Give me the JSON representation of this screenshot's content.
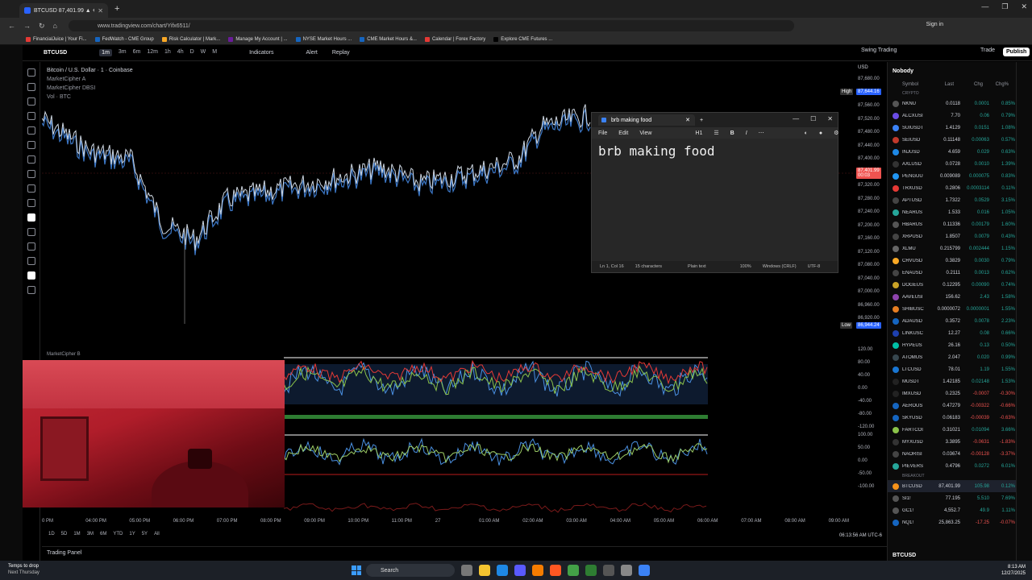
{
  "browser": {
    "tab_title": "BTCUSD 87,401.99 ▲ +0.12% S",
    "url": "www.tradingview.com/chart/Yifx6511/",
    "signin": "Sign in",
    "bookmarks": [
      "FinancialJuice | Your Fi...",
      "FedWatch - CME Group",
      "Risk Calculator | Mark...",
      "Manage My Account | ...",
      "NYSE Market Hours ...",
      "CME Market Hours &...",
      "Calendar | Forex Factory",
      "Explore CME Futures ..."
    ]
  },
  "toolbar": {
    "symbol": "BTCUSD",
    "timeframes": [
      "1m",
      "3m",
      "6m",
      "12m",
      "1h",
      "4h",
      "D",
      "W",
      "M"
    ],
    "active_timeframe": "1m",
    "indicators": "Indicators",
    "alert": "Alert",
    "replay": "Replay",
    "layout": "Swing Trading",
    "trade": "Trade",
    "publish": "Publish"
  },
  "chart": {
    "title": "Bitcoin / U.S. Dollar · 1 · Coinbase",
    "indicator1": "MarketCipher A",
    "indicator2": "MarketCipher DBSI",
    "indicator3": "Vol · BTC",
    "pane_label": "MarketCipher B",
    "currency": "USD",
    "high_label": "High",
    "high_value": "87,644.16",
    "low_label": "Low",
    "low_value": "86,944.24",
    "current_price": "87,401.99",
    "countdown": "00:03",
    "price_ticks": [
      "87,680.00",
      "87,600.00",
      "87,560.00",
      "87,520.00",
      "87,480.00",
      "87,440.00",
      "87,400.00",
      "87,360.00",
      "87,320.00",
      "87,280.00",
      "87,240.00",
      "87,200.00",
      "87,160.00",
      "87,120.00",
      "87,080.00",
      "87,040.00",
      "87,000.00",
      "86,960.00",
      "86,920.00"
    ],
    "osc_ticks": [
      "120.00",
      "80.00",
      "40.00",
      "0.00",
      "-40.00",
      "-80.00",
      "-120.00",
      "100.00",
      "50.00",
      "0.00",
      "-50.00",
      "-100.00"
    ],
    "time_ticks": [
      "0 PM",
      "04:00 PM",
      "05:00 PM",
      "06:00 PM",
      "07:00 PM",
      "08:00 PM",
      "09:00 PM",
      "10:00 PM",
      "11:00 PM",
      "27",
      "01:00 AM",
      "02:00 AM",
      "03:00 AM",
      "04:00 AM",
      "05:00 AM",
      "06:00 AM",
      "07:00 AM",
      "08:00 AM",
      "09:00 AM"
    ],
    "ranges": [
      "1D",
      "5D",
      "1M",
      "3M",
      "6M",
      "YTD",
      "1Y",
      "5Y",
      "All"
    ],
    "server_time": "06:13:56 AM UTC-6",
    "trading_panel": "Trading Panel"
  },
  "notepad": {
    "tab_title": "brb making food",
    "menu": [
      "File",
      "Edit",
      "View"
    ],
    "heading_btn": "H1",
    "content": "brb making food",
    "status": [
      "Ln 1, Col 16",
      "15 characters",
      "Plain text",
      "100%",
      "Windows (CRLF)",
      "UTF-8"
    ]
  },
  "watchlist": {
    "title": "Nobody",
    "cols": [
      "Symbol",
      "Last",
      "Chg",
      "Chg%"
    ],
    "section1": "CRYPTO",
    "section2": "BREAKOUT",
    "rows": [
      {
        "s": "NKNU",
        "l": "0.0118",
        "c": "0.0001",
        "p": "0.85%",
        "dir": "up",
        "ic": "#555"
      },
      {
        "s": "ALCXUSI",
        "l": "7.70",
        "c": "0.06",
        "p": "0.79%",
        "dir": "up",
        "ic": "#6b4ce6"
      },
      {
        "s": "SUIUSDT",
        "l": "1.4129",
        "c": "0.0151",
        "p": "1.08%",
        "dir": "up",
        "ic": "#3b82f6"
      },
      {
        "s": "SEIUSD",
        "l": "0.11148",
        "c": "0.00063",
        "p": "0.57%",
        "dir": "up",
        "ic": "#c0392b"
      },
      {
        "s": "INJUSD",
        "l": "4.659",
        "c": "0.029",
        "p": "0.63%",
        "dir": "up",
        "ic": "#1e88e5"
      },
      {
        "s": "AXLUSD",
        "l": "0.0728",
        "c": "0.0010",
        "p": "1.39%",
        "dir": "up",
        "ic": "#333"
      },
      {
        "s": "PENGUU",
        "l": "0.009089",
        "c": "0.000075",
        "p": "0.83%",
        "dir": "up",
        "ic": "#2196f3"
      },
      {
        "s": "TRXUSD",
        "l": "0.2806",
        "c": "0.0003114",
        "p": "0.11%",
        "dir": "up",
        "ic": "#e53935"
      },
      {
        "s": "APTUSD",
        "l": "1.7322",
        "c": "0.0529",
        "p": "3.15%",
        "dir": "up",
        "ic": "#444"
      },
      {
        "s": "NEARUS",
        "l": "1.533",
        "c": "0.016",
        "p": "1.05%",
        "dir": "up",
        "ic": "#26a69a"
      },
      {
        "s": "HBARUS",
        "l": "0.11336",
        "c": "0.00179",
        "p": "1.60%",
        "dir": "up",
        "ic": "#555"
      },
      {
        "s": "XRPUSD",
        "l": "1.8507",
        "c": "0.0079",
        "p": "0.43%",
        "dir": "up",
        "ic": "#444"
      },
      {
        "s": "XLMU",
        "l": "0.215799",
        "c": "0.002444",
        "p": "1.15%",
        "dir": "up",
        "ic": "#666"
      },
      {
        "s": "CRVUSD",
        "l": "0.3829",
        "c": "0.0030",
        "p": "0.79%",
        "dir": "up",
        "ic": "#f9a825"
      },
      {
        "s": "ENAUSD",
        "l": "0.2111",
        "c": "0.0013",
        "p": "0.62%",
        "dir": "up",
        "ic": "#444"
      },
      {
        "s": "DOGEUS",
        "l": "0.12295",
        "c": "0.00090",
        "p": "0.74%",
        "dir": "up",
        "ic": "#c9a227"
      },
      {
        "s": "AAVEUSI",
        "l": "156.62",
        "c": "2.43",
        "p": "1.58%",
        "dir": "up",
        "ic": "#8e44ad"
      },
      {
        "s": "SHIBUSC",
        "l": "0.0000072",
        "c": "0.0000001",
        "p": "1.55%",
        "dir": "up",
        "ic": "#e67e22"
      },
      {
        "s": "ADAUSD",
        "l": "0.3572",
        "c": "0.0078",
        "p": "2.23%",
        "dir": "up",
        "ic": "#1565c0"
      },
      {
        "s": "LINKUSC",
        "l": "12.27",
        "c": "0.08",
        "p": "0.66%",
        "dir": "up",
        "ic": "#1e40af"
      },
      {
        "s": "HYPEUS",
        "l": "26.16",
        "c": "0.13",
        "p": "0.50%",
        "dir": "up",
        "ic": "#00bfa5"
      },
      {
        "s": "ATOMUS",
        "l": "2.047",
        "c": "0.020",
        "p": "0.99%",
        "dir": "up",
        "ic": "#37474f"
      },
      {
        "s": "LTCUSD",
        "l": "78.01",
        "c": "1.19",
        "p": "1.55%",
        "dir": "up",
        "ic": "#1976d2"
      },
      {
        "s": "MUSDT",
        "l": "1.42185",
        "c": "0.02148",
        "p": "1.53%",
        "dir": "up",
        "ic": "#222"
      },
      {
        "s": "IMXUSD",
        "l": "0.2325",
        "c": "-0.0007",
        "p": "-0.30%",
        "dir": "dn",
        "ic": "#222"
      },
      {
        "s": "AEROUS",
        "l": "0.47279",
        "c": "-0.00322",
        "p": "-0.66%",
        "dir": "dn",
        "ic": "#1565c0"
      },
      {
        "s": "SKYUSD",
        "l": "0.06183",
        "c": "-0.00039",
        "p": "-0.63%",
        "dir": "dn",
        "ic": "#1565c0"
      },
      {
        "s": "FARTCOI",
        "l": "0.31021",
        "c": "0.01094",
        "p": "3.66%",
        "dir": "up",
        "ic": "#8bc34a"
      },
      {
        "s": "MYXUSD",
        "l": "3.3895",
        "c": "-0.0631",
        "p": "-1.83%",
        "dir": "dn",
        "ic": "#333"
      },
      {
        "s": "NAORISI",
        "l": "0.03674",
        "c": "-0.00128",
        "p": "-3.37%",
        "dir": "dn",
        "ic": "#444"
      },
      {
        "s": "PIEVERS",
        "l": "0.4796",
        "c": "0.0272",
        "p": "6.01%",
        "dir": "up",
        "ic": "#26a69a"
      }
    ],
    "breakout_rows": [
      {
        "s": "BTCUSD",
        "l": "87,401.99",
        "c": "105.98",
        "p": "0.12%",
        "dir": "up",
        "ic": "#f7931a"
      },
      {
        "s": "SI1!",
        "l": "77.195",
        "c": "5.510",
        "p": "7.69%",
        "dir": "up",
        "ic": "#555"
      },
      {
        "s": "GC1!",
        "l": "4,552.7",
        "c": "49.9",
        "p": "1.11%",
        "dir": "up",
        "ic": "#555"
      },
      {
        "s": "NQ1!",
        "l": "25,863.25",
        "c": "-17.25",
        "p": "-0.07%",
        "dir": "dn",
        "ic": "#1565c0"
      }
    ],
    "footer_symbol": "BTCUSD"
  },
  "taskbar": {
    "weather_title": "Temps to drop",
    "weather_sub": "Next Thursday",
    "search": "Search",
    "time": "8:13 AM",
    "date": "12/27/2025"
  }
}
